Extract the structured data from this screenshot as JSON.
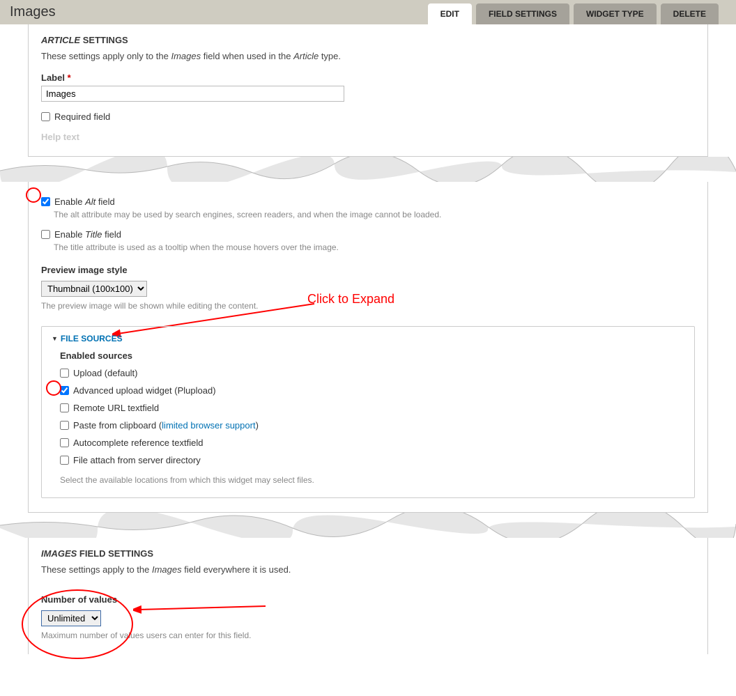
{
  "page_title": "Images",
  "tabs": {
    "edit": "EDIT",
    "field_settings": "FIELD SETTINGS",
    "widget_type": "WIDGET TYPE",
    "delete": "DELETE"
  },
  "article": {
    "heading_bold_italic": "ARTICLE",
    "heading_rest": " SETTINGS",
    "desc_a": "These settings apply only to the ",
    "desc_b_italic": "Images",
    "desc_c": " field when used in the ",
    "desc_d_italic": "Article",
    "desc_e": " type.",
    "label_label": "Label",
    "label_value": "Images",
    "required_label": "Required field",
    "help_text_label": "Help text",
    "enable_alt_a": "Enable ",
    "enable_alt_b_italic": "Alt",
    "enable_alt_c": " field",
    "enable_alt_help": "The alt attribute may be used by search engines, screen readers, and when the image cannot be loaded.",
    "enable_title_a": "Enable ",
    "enable_title_b_italic": "Title",
    "enable_title_c": " field",
    "enable_title_help": "The title attribute is used as a tooltip when the mouse hovers over the image.",
    "preview_label": "Preview image style",
    "preview_value": "Thumbnail (100x100)",
    "preview_help": "The preview image will be shown while editing the content.",
    "click_expand": "Click to Expand"
  },
  "file_sources": {
    "legend": "FILE SOURCES",
    "enabled_heading": "Enabled sources",
    "upload": "Upload (default)",
    "plupload": "Advanced upload widget (Plupload)",
    "remote": "Remote URL textfield",
    "paste_a": "Paste from clipboard (",
    "paste_link": "limited browser support",
    "paste_b": ")",
    "autocomplete": "Autocomplete reference textfield",
    "attach": "File attach from server directory",
    "help": "Select the available locations from which this widget may select files."
  },
  "field_settings": {
    "heading_bold_italic": "IMAGES",
    "heading_rest": " FIELD SETTINGS",
    "desc_a": "These settings apply to the ",
    "desc_b_italic": "Images",
    "desc_c": " field everywhere it is used.",
    "nov_label": "Number of values",
    "nov_value": "Unlimited",
    "nov_help": "Maximum number of values users can enter for this field."
  }
}
